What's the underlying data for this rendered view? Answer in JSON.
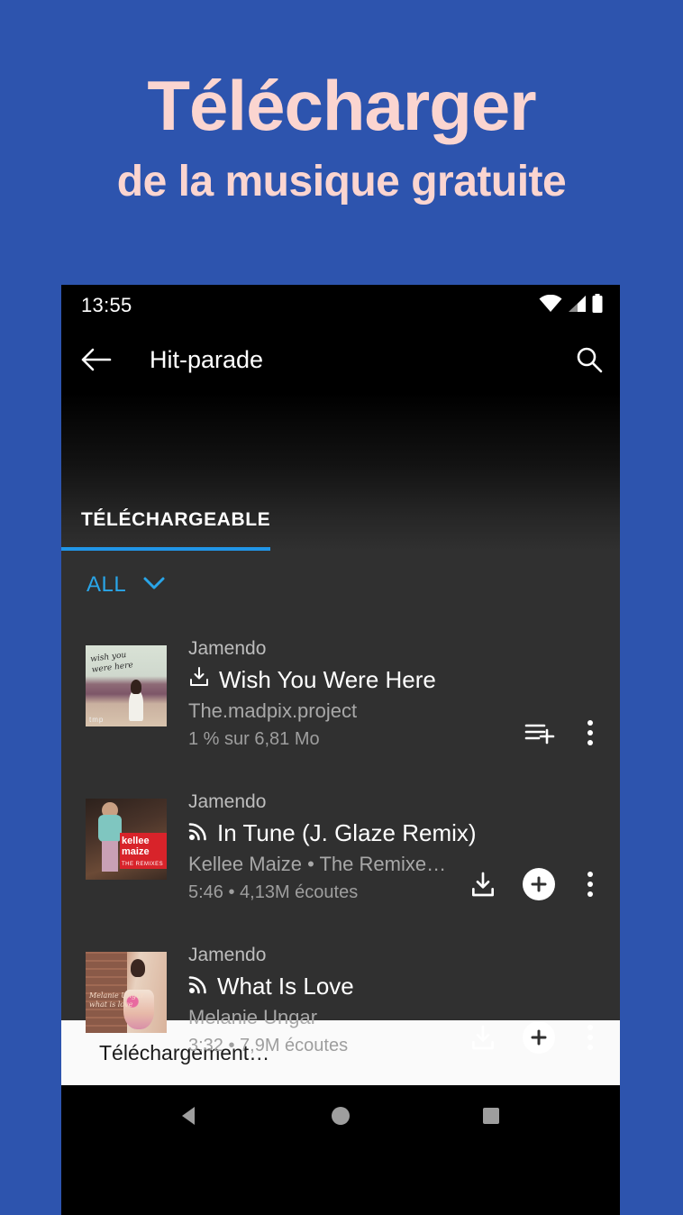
{
  "poster": {
    "headline_line1": "Télécharger",
    "headline_line2": "de la musique gratuite",
    "background_color": "#2d54ae",
    "headline_color": "#fbd5d0"
  },
  "phone": {
    "statusbar": {
      "time": "13:55",
      "icons": [
        "wifi-icon",
        "cellular-signal-icon",
        "battery-icon"
      ]
    },
    "appbar": {
      "back_icon": "back-arrow-icon",
      "title": "Hit-parade",
      "search_icon": "search-icon"
    },
    "tabs": [
      {
        "label": "TÉLÉCHARGEABLE",
        "active": true,
        "indicator_color": "#2196e8"
      }
    ],
    "filter": {
      "label": "ALL",
      "chevron_icon": "chevron-down-icon",
      "color": "#29a5e8"
    },
    "tracks": [
      {
        "provider": "Jamendo",
        "title": "Wish You Were Here",
        "title_icon": "download-icon",
        "artist": "The.madpix.project",
        "subtitle": "1 % sur 6,81 Mo",
        "artwork": "wish-you-were-here-cover",
        "actions": [
          "playlist-add-icon",
          "overflow-menu-icon"
        ]
      },
      {
        "provider": "Jamendo",
        "title": "In Tune (J. Glaze Remix)",
        "title_icon": "stream-icon",
        "artist": "Kellee Maize • The Remixe…",
        "subtitle": "5:46 • 4,13M écoutes",
        "artwork": "kellee-maize-the-remixes-cover",
        "actions": [
          "download-icon",
          "add-icon",
          "overflow-menu-icon"
        ]
      },
      {
        "provider": "Jamendo",
        "title": "What Is Love",
        "title_icon": "stream-icon",
        "artist": "Melanie Ungar",
        "subtitle": "3:32 • 7,9M écoutes",
        "artwork": "melanie-ungar-what-is-love-cover",
        "actions": [
          "download-icon",
          "add-icon",
          "overflow-menu-icon"
        ]
      }
    ],
    "snackbar": {
      "text": "Téléchargement…"
    },
    "navbar": {
      "back_icon": "nav-back-triangle-icon",
      "home_icon": "nav-home-circle-icon",
      "recents_icon": "nav-recents-square-icon"
    }
  }
}
